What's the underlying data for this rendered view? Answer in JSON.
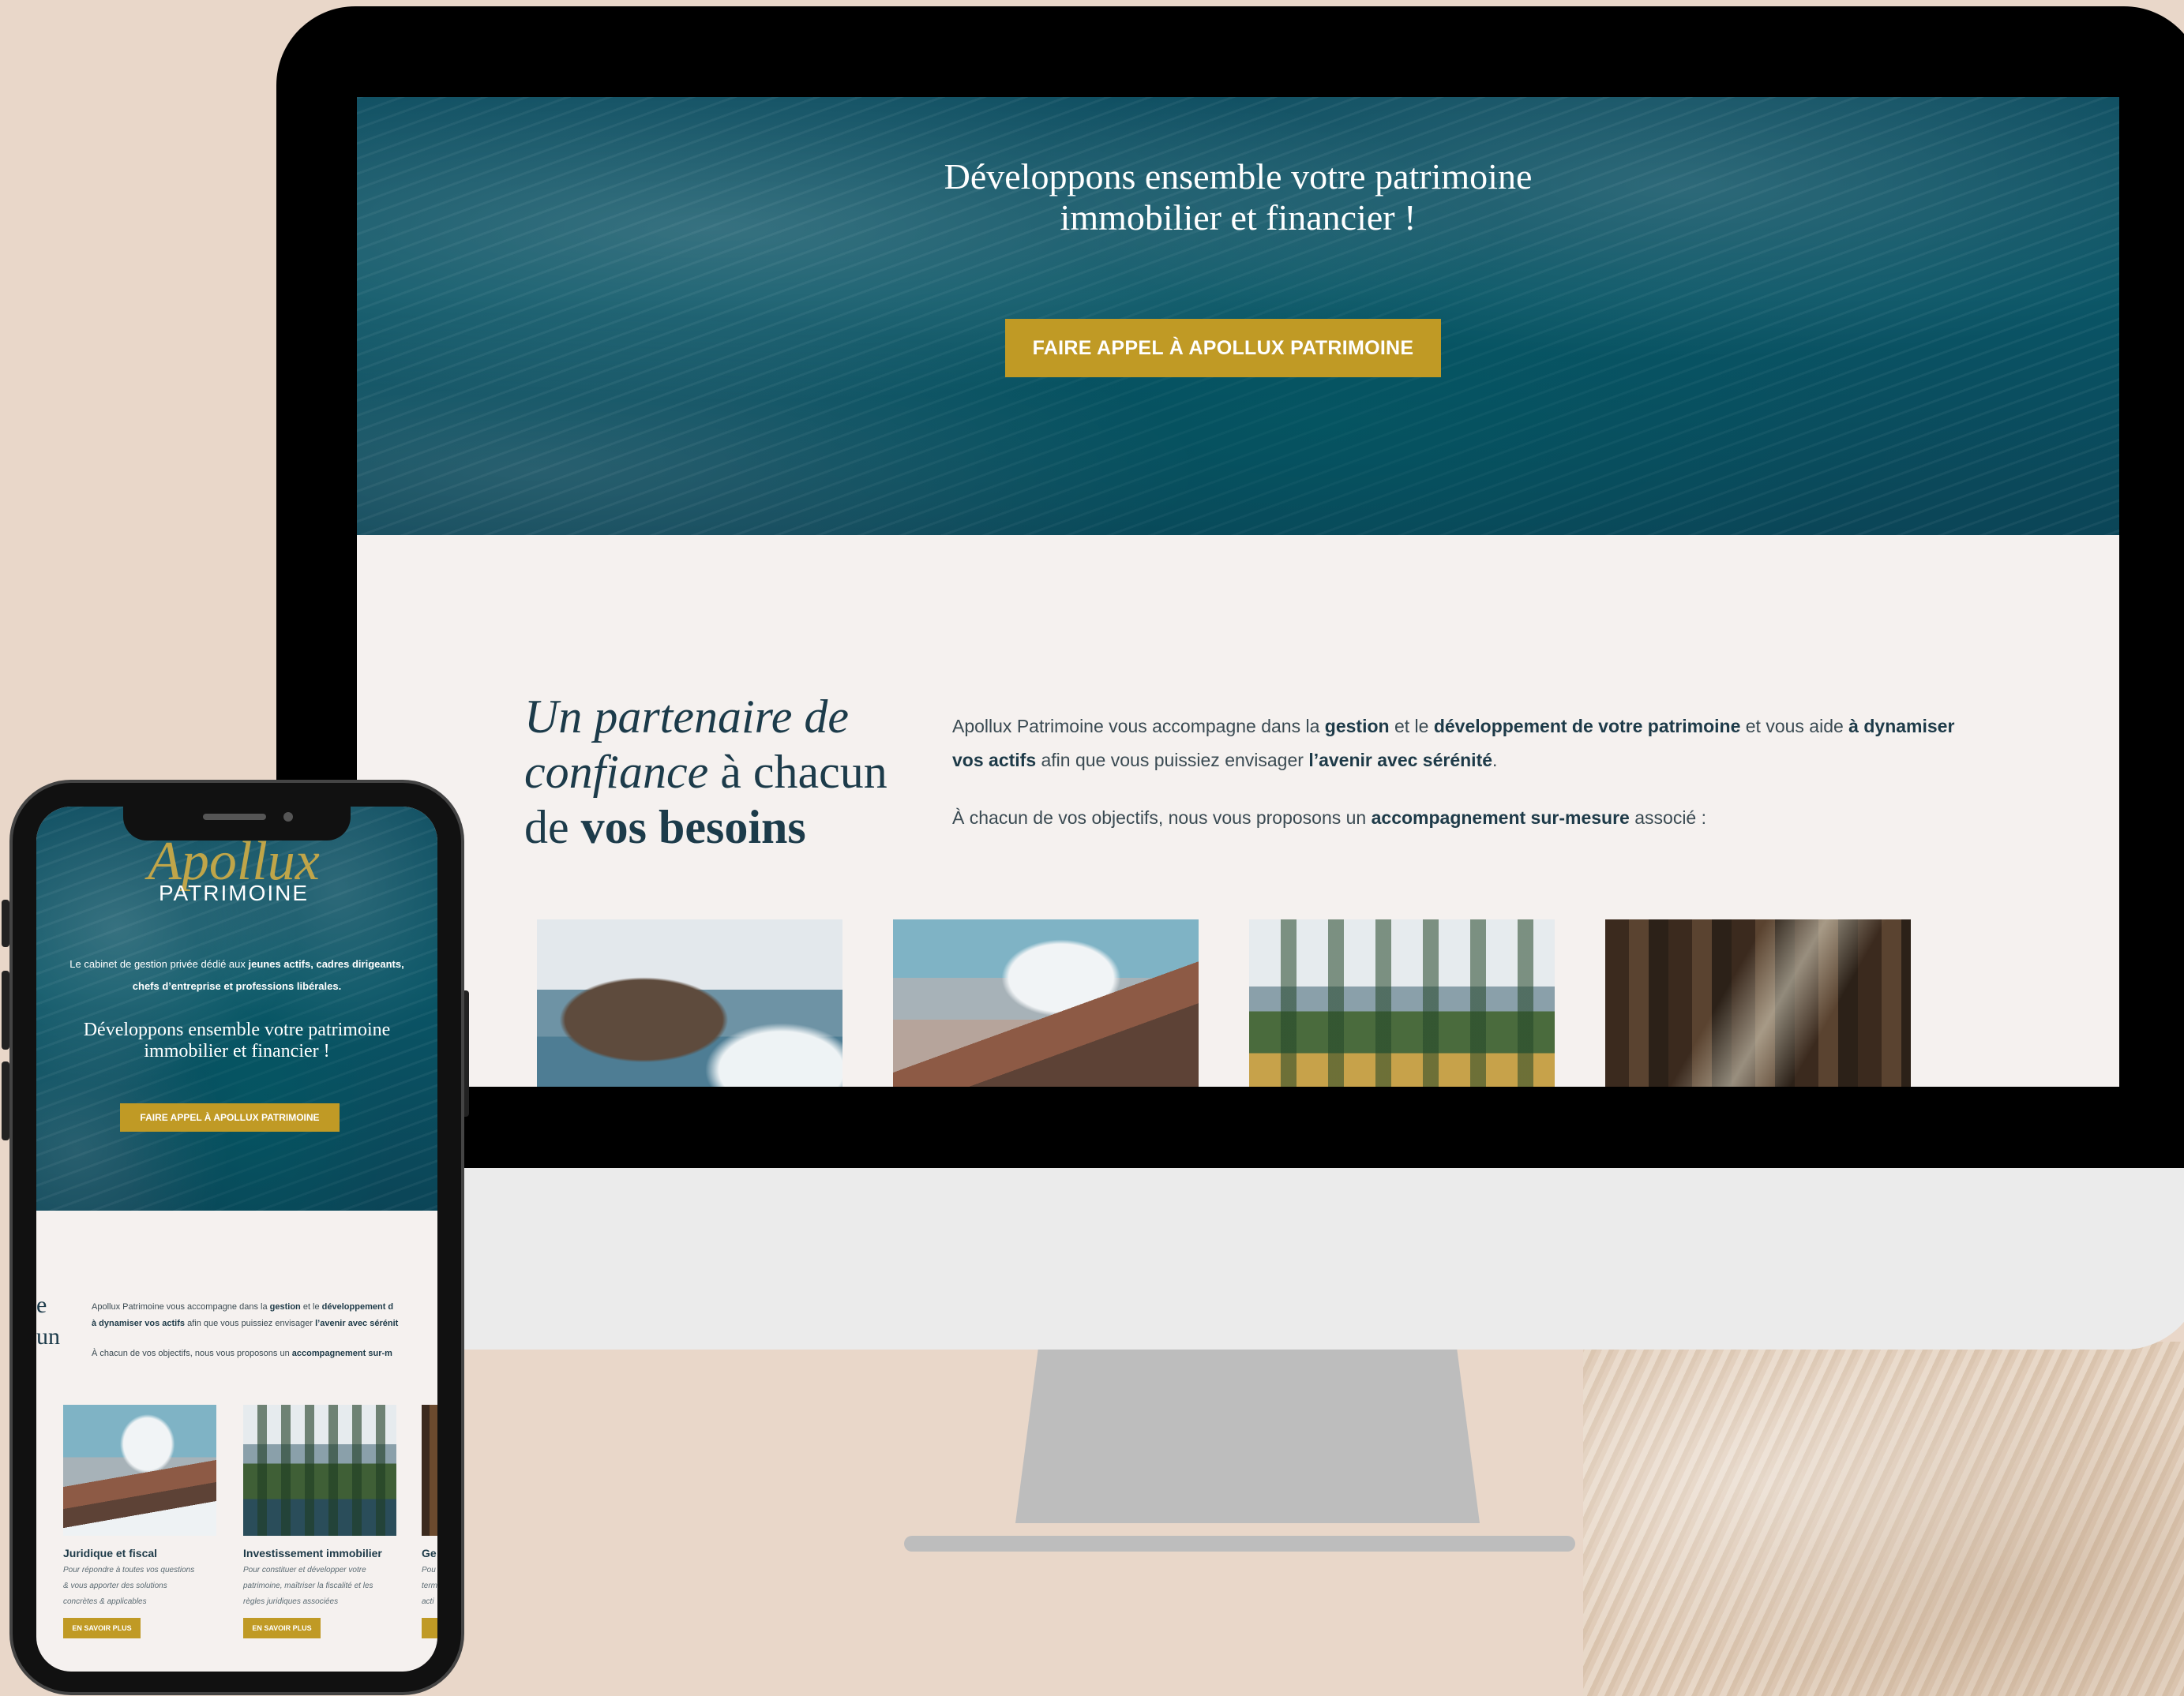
{
  "desktop": {
    "hero": {
      "title_line1": "Développons ensemble votre patrimoine",
      "title_line2": "immobilier et financier !",
      "cta_label": "FAIRE APPEL À APOLLUX PATRIMOINE"
    },
    "intro": {
      "heading_italic": "Un partenaire de confiance",
      "heading_mid": " à chacun de ",
      "heading_bold": "vos besoins",
      "p1_a": "Apollux Patrimoine vous accompagne dans la ",
      "p1_b": "gestion",
      "p1_c": " et le ",
      "p1_d": "développement de votre patrimoine",
      "p1_e": " et vous aide ",
      "p1_f": "à dynamiser vos actifs",
      "p1_g": " afin que vous puissiez envisager ",
      "p1_h": "l’avenir avec sérénité",
      "p1_i": ".",
      "p2_a": "À chacun de vos objectifs, nous vous proposons un ",
      "p2_b": "accompagnement sur-mesure",
      "p2_c": " associé :"
    }
  },
  "mobile": {
    "logo_script": "Apollux",
    "logo_word": "PATRIMOINE",
    "tagline_a": "Le cabinet de gestion privée dédié aux ",
    "tagline_b": "jeunes actifs, cadres dirigeants,",
    "tagline_c": "chefs d’entreprise et professions libérales.",
    "hero_title_line1": "Développons ensemble votre patrimoine",
    "hero_title_line2": "immobilier et financier !",
    "cta_label": "FAIRE APPEL À APOLLUX PATRIMOINE",
    "heading_fragment_1": "e",
    "heading_fragment_2": "un",
    "p1_a": "Apollux Patrimoine vous accompagne dans la ",
    "p1_b": "gestion",
    "p1_c": " et le ",
    "p1_d": "développement d",
    "p1_e": "à dynamiser vos actifs",
    "p1_f": " afin que vous puissiez envisager ",
    "p1_g": "l’avenir avec sérénit",
    "p2_a": "À chacun de vos objectifs, nous vous proposons un ",
    "p2_b": "accompagnement sur-m",
    "cards": [
      {
        "title": "Juridique et fiscal",
        "desc1": "Pour répondre à toutes vos questions",
        "desc2": "& vous apporter des solutions",
        "desc3": "concrètes & applicables",
        "button": "EN SAVOIR PLUS"
      },
      {
        "title": "Investissement immobilier",
        "desc1": "Pour constituer et développer votre",
        "desc2": "patrimoine, maîtriser la fiscalité et les",
        "desc3": "règles juridiques associées",
        "button": "EN SAVOIR PLUS"
      },
      {
        "title": "Ge",
        "desc1": "Pou",
        "desc2": "term",
        "desc3": "acti",
        "button": "EN"
      }
    ]
  }
}
